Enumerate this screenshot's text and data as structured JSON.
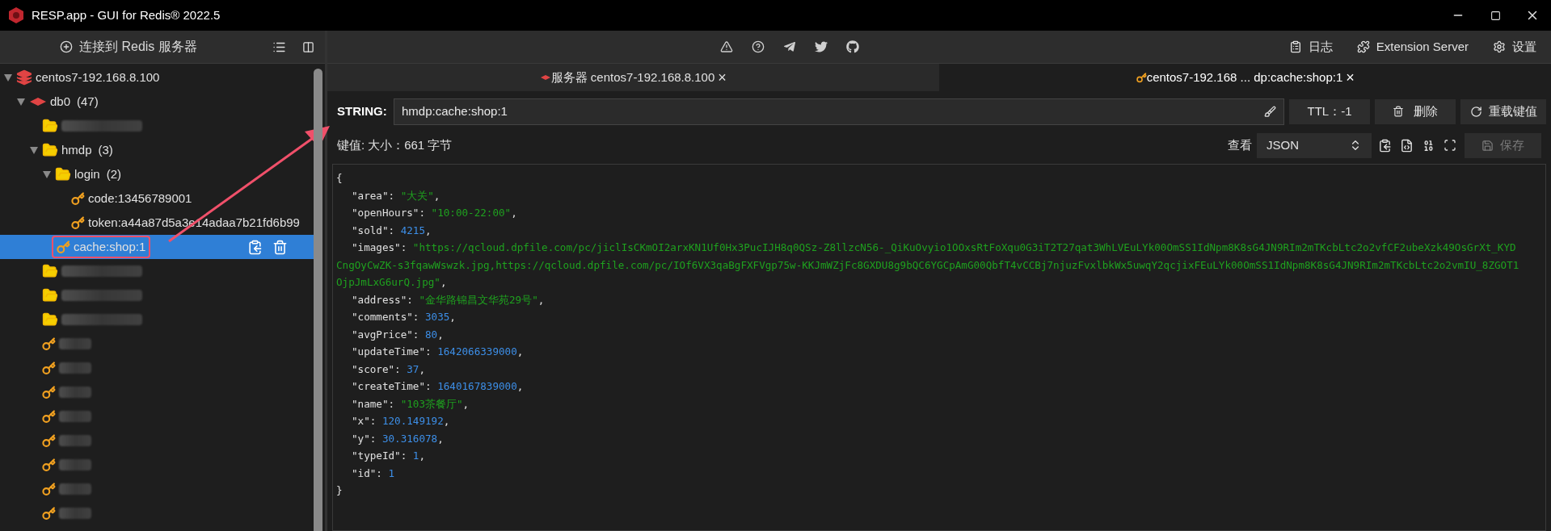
{
  "window": {
    "title": "RESP.app - GUI for Redis® 2022.5"
  },
  "sidebar": {
    "connect_button": "连接到 Redis 服务器",
    "tree": [
      {
        "kind": "server",
        "label": "centos7-192.168.8.100",
        "expanded": true,
        "children": [
          {
            "kind": "database",
            "label": "db0",
            "count": "(47)",
            "expanded": true,
            "children": [
              {
                "kind": "folder",
                "redacted": true
              },
              {
                "kind": "folder",
                "label": "hmdp",
                "count": "(3)",
                "expanded": true,
                "children": [
                  {
                    "kind": "folder",
                    "label": "login",
                    "count": "(2)",
                    "expanded": true,
                    "children": [
                      {
                        "kind": "key",
                        "label": "code:13456789001",
                        "selected": false
                      },
                      {
                        "kind": "key",
                        "label": "token:a44a87d5a3e14adaa7b21fd6b99",
                        "selected": false
                      }
                    ]
                  },
                  {
                    "kind": "key",
                    "label": "cache:shop:1",
                    "selected": true
                  }
                ]
              },
              {
                "kind": "folder",
                "redacted": true
              },
              {
                "kind": "folder",
                "redacted": true
              },
              {
                "kind": "folder",
                "redacted": true
              },
              {
                "kind": "key",
                "redacted": true
              },
              {
                "kind": "key",
                "redacted": true
              },
              {
                "kind": "key",
                "redacted": true
              },
              {
                "kind": "key",
                "redacted": true
              },
              {
                "kind": "key",
                "redacted": true
              },
              {
                "kind": "key",
                "redacted": true
              },
              {
                "kind": "key",
                "redacted": true
              },
              {
                "kind": "key",
                "redacted": true
              }
            ]
          }
        ]
      }
    ]
  },
  "toolbar": {
    "right_buttons": [
      {
        "kind": "log",
        "label": "日志"
      },
      {
        "kind": "extension",
        "label": "Extension Server"
      },
      {
        "kind": "settings",
        "label": "设置"
      }
    ]
  },
  "tabs": [
    {
      "kind": "server",
      "label": "服务器 centos7-192.168.8.100",
      "close": "×",
      "selected": false
    },
    {
      "kind": "key",
      "label": "centos7-192.168 ... dp:cache:shop:1",
      "close": "×",
      "selected": true
    }
  ],
  "key_panel": {
    "type": "STRING:",
    "key_name": "hmdp:cache:shop:1",
    "ttl": "TTL：-1",
    "delete": "删除",
    "reload": "重载键值",
    "size_label": "键值:",
    "size": "大小：661 字节",
    "view_label": "查看",
    "view_mode": "JSON",
    "save": "保存",
    "open": "{",
    "close": "}",
    "lines": [
      {
        "key": "\"area\":",
        "value": "\"大关\"",
        "kind": "string",
        "trail": ","
      },
      {
        "key": "\"openHours\":",
        "value": "\"10:00-22:00\"",
        "kind": "string",
        "trail": ","
      },
      {
        "key": "\"sold\":",
        "value": "4215",
        "kind": "number",
        "trail": ","
      },
      {
        "key": "\"images\":",
        "value": "\"https://qcloud.dpfile.com/pc/jiclIsCKmOI2arxKN1Uf0Hx3PucIJH8q0QSz-Z8llzcN56-_QiKuOvyio1OOxsRtFoXqu0G3iT2T27qat3WhLVEuLYk00OmSS1IdNpm8K8sG4JN9RIm2mTKcbLtc2o2vfCF2ubeXzk49OsGrXt_KYDCngOyCwZK-s3fqawWswzk.jpg,https://qcloud.dpfile.com/pc/IOf6VX3qaBgFXFVgp75w-KKJmWZjFc8GXDU8g9bQC6YGCpAmG00QbfT4vCCBj7njuzFvxlbkWx5uwqY2qcjixFEuLYk00OmSS1IdNpm8K8sG4JN9RIm2mTKcbLtc2o2vmIU_8ZGOT1OjpJmLxG6urQ.jpg\"",
        "kind": "string",
        "trail": ","
      },
      {
        "key": "\"address\":",
        "value": "\"金华路锦昌文华苑29号\"",
        "kind": "string",
        "trail": ","
      },
      {
        "key": "\"comments\":",
        "value": "3035",
        "kind": "number",
        "trail": ","
      },
      {
        "key": "\"avgPrice\":",
        "value": "80",
        "kind": "number",
        "trail": ","
      },
      {
        "key": "\"updateTime\":",
        "value": "1642066339000",
        "kind": "number",
        "trail": ","
      },
      {
        "key": "\"score\":",
        "value": "37",
        "kind": "number",
        "trail": ","
      },
      {
        "key": "\"createTime\":",
        "value": "1640167839000",
        "kind": "number",
        "trail": ","
      },
      {
        "key": "\"name\":",
        "value": "\"103茶餐厅\"",
        "kind": "string",
        "trail": ","
      },
      {
        "key": "\"x\":",
        "value": "120.149192",
        "kind": "number",
        "trail": ","
      },
      {
        "key": "\"y\":",
        "value": "30.316078",
        "kind": "number",
        "trail": ","
      },
      {
        "key": "\"typeId\":",
        "value": "1",
        "kind": "number",
        "trail": ","
      },
      {
        "key": "\"id\":",
        "value": "1",
        "kind": "number"
      }
    ]
  }
}
